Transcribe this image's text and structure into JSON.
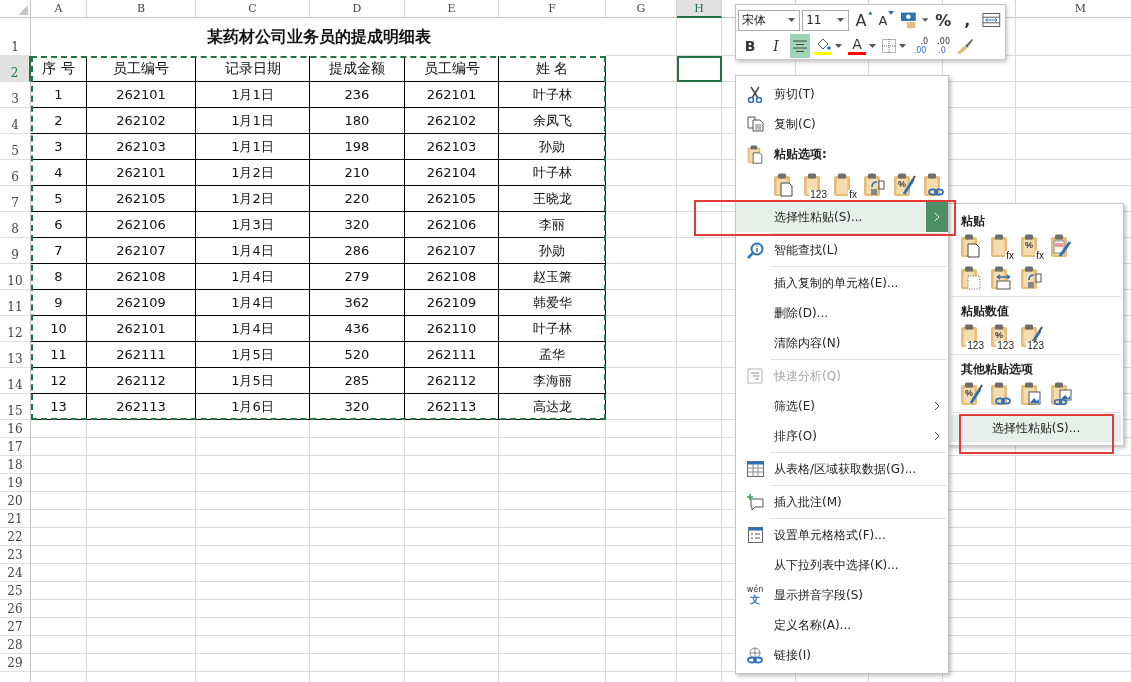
{
  "sheet": {
    "copied": true,
    "columns": [
      {
        "label": "A",
        "selected": false
      },
      {
        "label": "B",
        "selected": false
      },
      {
        "label": "C",
        "selected": false
      },
      {
        "label": "D",
        "selected": false
      },
      {
        "label": "E",
        "selected": false
      },
      {
        "label": "F",
        "selected": false
      },
      {
        "label": "G",
        "selected": false
      },
      {
        "label": "H",
        "selected": true
      },
      {
        "label": "M",
        "selected": false
      }
    ],
    "rows": [
      {
        "label": "1",
        "selected": false
      },
      {
        "label": "2",
        "selected": true
      },
      {
        "label": "3",
        "selected": false
      },
      {
        "label": "4",
        "selected": false
      },
      {
        "label": "5",
        "selected": false
      },
      {
        "label": "6",
        "selected": false
      },
      {
        "label": "7",
        "selected": false
      },
      {
        "label": "8",
        "selected": false
      },
      {
        "label": "9",
        "selected": false
      },
      {
        "label": "10",
        "selected": false
      },
      {
        "label": "11",
        "selected": false
      },
      {
        "label": "12",
        "selected": false
      },
      {
        "label": "13",
        "selected": false
      },
      {
        "label": "14",
        "selected": false
      },
      {
        "label": "15",
        "selected": false
      },
      {
        "label": "16",
        "selected": false
      },
      {
        "label": "17",
        "selected": false
      },
      {
        "label": "18",
        "selected": false
      },
      {
        "label": "19",
        "selected": false
      },
      {
        "label": "20",
        "selected": false
      },
      {
        "label": "21",
        "selected": false
      },
      {
        "label": "22",
        "selected": false
      },
      {
        "label": "23",
        "selected": false
      },
      {
        "label": "24",
        "selected": false
      },
      {
        "label": "25",
        "selected": false
      },
      {
        "label": "26",
        "selected": false
      },
      {
        "label": "27",
        "selected": false
      },
      {
        "label": "28",
        "selected": false
      },
      {
        "label": "29",
        "selected": false
      }
    ],
    "title": "某药材公司业务员的提成明细表",
    "table_header": [
      "序 号",
      "员工编号",
      "记录日期",
      "提成金额",
      "员工编号",
      "姓 名"
    ],
    "table_rows": [
      [
        "1",
        "262101",
        "1月1日",
        "236",
        "262101",
        "叶子林"
      ],
      [
        "2",
        "262102",
        "1月1日",
        "180",
        "262102",
        "余凤飞"
      ],
      [
        "3",
        "262103",
        "1月1日",
        "198",
        "262103",
        "孙勋"
      ],
      [
        "4",
        "262101",
        "1月2日",
        "210",
        "262104",
        "叶子林"
      ],
      [
        "5",
        "262105",
        "1月2日",
        "220",
        "262105",
        "王晓龙"
      ],
      [
        "6",
        "262106",
        "1月3日",
        "320",
        "262106",
        "李丽"
      ],
      [
        "7",
        "262107",
        "1月4日",
        "286",
        "262107",
        "孙勋"
      ],
      [
        "8",
        "262108",
        "1月4日",
        "279",
        "262108",
        "赵玉箫"
      ],
      [
        "9",
        "262109",
        "1月4日",
        "362",
        "262109",
        "韩爱华"
      ],
      [
        "10",
        "262101",
        "1月4日",
        "436",
        "262110",
        "叶子林"
      ],
      [
        "11",
        "262111",
        "1月5日",
        "520",
        "262111",
        "孟华"
      ],
      [
        "12",
        "262112",
        "1月5日",
        "285",
        "262112",
        "李海丽"
      ],
      [
        "13",
        "262113",
        "1月6日",
        "320",
        "262113",
        "高达龙"
      ]
    ]
  },
  "mini_toolbar": {
    "font_name": "宋体",
    "font_size": "11",
    "row1": [
      {
        "kind": "grow_font",
        "label": "A"
      },
      {
        "kind": "shrink_font",
        "label": "A"
      },
      {
        "kind": "accounting",
        "dropdown": true
      },
      {
        "kind": "text",
        "label": "%"
      },
      {
        "kind": "text",
        "label": ","
      },
      {
        "kind": "wrap"
      }
    ],
    "row2": [
      {
        "kind": "bold",
        "label": "B",
        "selected": false
      },
      {
        "kind": "italic",
        "label": "I",
        "selected": false
      },
      {
        "kind": "align_center",
        "selected": true
      },
      {
        "kind": "fill",
        "color": "#ffff00",
        "dropdown": true,
        "selected": false
      },
      {
        "kind": "font_color",
        "label": "A",
        "color": "#ff0000",
        "dropdown": true,
        "selected": false
      },
      {
        "kind": "borders",
        "dropdown": true,
        "selected": false
      },
      {
        "kind": "decimal_up",
        "top": ".0",
        "bottom": ".00",
        "selected": false
      },
      {
        "kind": "decimal_down",
        "top": ".00",
        "bottom": ".0",
        "selected": false
      },
      {
        "kind": "painter",
        "selected": false
      }
    ]
  },
  "context_menu": {
    "items": [
      {
        "kind": "command",
        "label": "剪切(T)"
      },
      {
        "kind": "command",
        "label": "复制(C)"
      },
      {
        "kind": "heading",
        "label": "粘贴选项:"
      },
      {
        "kind": "paste_options",
        "icons": [
          {
            "kind": "doc"
          },
          {
            "kind": "plain",
            "bottom_text": "123"
          },
          {
            "kind": "plain",
            "bottom_text": "fx"
          },
          {
            "kind": "swap"
          },
          {
            "kind": "brush",
            "top_text": "%"
          },
          {
            "kind": "link"
          }
        ]
      },
      {
        "kind": "command",
        "label": "选择性粘贴(S)...",
        "selected": true,
        "submenu": true,
        "framed": true
      },
      {
        "kind": "separator"
      },
      {
        "kind": "command",
        "label": "智能查找(L)"
      },
      {
        "kind": "separator"
      },
      {
        "kind": "command",
        "label": "插入复制的单元格(E)..."
      },
      {
        "kind": "command",
        "label": "删除(D)..."
      },
      {
        "kind": "command",
        "label": "清除内容(N)"
      },
      {
        "kind": "separator"
      },
      {
        "kind": "command",
        "label": "快速分析(Q)",
        "disabled": true
      },
      {
        "kind": "command",
        "label": "筛选(E)",
        "submenu": true
      },
      {
        "kind": "command",
        "label": "排序(O)",
        "submenu": true
      },
      {
        "kind": "separator"
      },
      {
        "kind": "command",
        "label": "从表格/区域获取数据(G)..."
      },
      {
        "kind": "separator"
      },
      {
        "kind": "command",
        "label": "插入批注(M)"
      },
      {
        "kind": "separator"
      },
      {
        "kind": "command",
        "label": "设置单元格格式(F)..."
      },
      {
        "kind": "command",
        "label": "从下拉列表中选择(K)..."
      },
      {
        "kind": "command",
        "label": "显示拼音字段(S)",
        "icon_texts": [
          "wén",
          "文"
        ]
      },
      {
        "kind": "command",
        "label": "定义名称(A)..."
      },
      {
        "kind": "command",
        "label": "链接(I)"
      }
    ]
  },
  "paste_submenu": {
    "sections": [
      {
        "title": "粘贴",
        "icons": [
          {
            "kind": "doc"
          },
          {
            "kind": "plain",
            "bottom_text": "fx"
          },
          {
            "kind": "plain",
            "top_text": "%",
            "bottom_text": "fx"
          },
          {
            "kind": "sheet_brush"
          },
          {
            "kind": "dots"
          },
          {
            "kind": "arrows"
          },
          {
            "kind": "swap"
          }
        ]
      },
      {
        "title": "粘贴数值",
        "icons": [
          {
            "kind": "plain",
            "bottom_text": "123"
          },
          {
            "kind": "plain",
            "top_text": "%",
            "bottom_text": "123"
          },
          {
            "kind": "brush",
            "bottom_text": "123"
          }
        ]
      },
      {
        "title": "其他粘贴选项",
        "icons": [
          {
            "kind": "brush",
            "top_text": "%"
          },
          {
            "kind": "link"
          },
          {
            "kind": "image"
          },
          {
            "kind": "image_link"
          }
        ]
      }
    ],
    "footer": {
      "label": "选择性粘贴(S)...",
      "selected": true,
      "framed": true
    }
  }
}
